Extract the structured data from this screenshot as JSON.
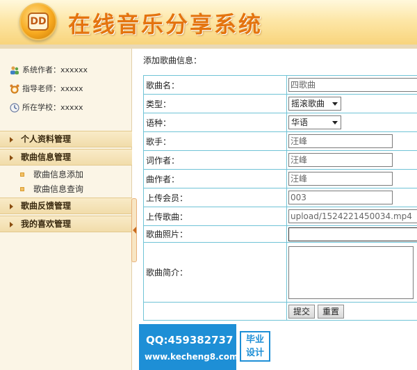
{
  "header": {
    "logo_text": "DD",
    "title": "在线音乐分享系统"
  },
  "sidebar": {
    "info": {
      "author": "系统作者：xxxxxx",
      "teacher": "指导老师：xxxxx",
      "school": "所在学校：xxxxx"
    },
    "nav": {
      "personal": "个人资料管理",
      "song_info": "歌曲信息管理",
      "song_add": "歌曲信息添加",
      "song_query": "歌曲信息查询",
      "feedback": "歌曲反馈管理",
      "favorites": "我的喜欢管理"
    }
  },
  "form": {
    "panel_title": "添加歌曲信息：",
    "fields": {
      "song_name_label": "歌曲名：",
      "song_name_value": "四歌曲",
      "type_label": "类型：",
      "type_value": "摇滚歌曲",
      "language_label": "语种：",
      "language_value": "华语",
      "singer_label": "歌手：",
      "singer_value": "汪峰",
      "lyricist_label": "词作者：",
      "lyricist_value": "汪峰",
      "composer_label": "曲作者：",
      "composer_value": "汪峰",
      "uploader_label": "上传会员：",
      "uploader_value": "003",
      "song_file_label": "上传歌曲：",
      "song_file_value": "upload/1524221450034.mp4",
      "photo_label": "歌曲照片：",
      "photo_value": "",
      "intro_label": "歌曲简介："
    },
    "buttons": {
      "submit": "提交",
      "reset": "重置"
    }
  },
  "watermark": {
    "qq": "QQ:459382737",
    "url": "www.kecheng8.com",
    "badge_line1": "毕业",
    "badge_line2": "设计"
  }
}
